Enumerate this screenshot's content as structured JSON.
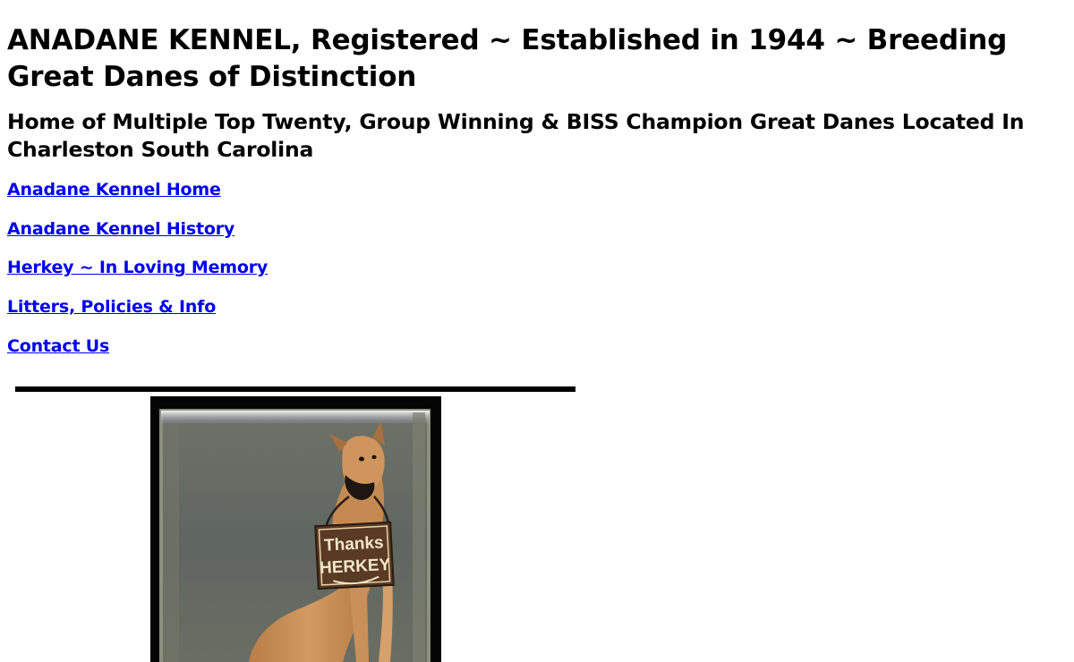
{
  "header": {
    "title": "ANADANE KENNEL, Registered ~ Established in 1944 ~ Breeding Great Danes of Distinction",
    "subtitle": "Home of Multiple Top Twenty, Group Winning & BISS Champion Great Danes Located In Charleston South Carolina"
  },
  "nav": {
    "links": [
      {
        "label": "Anadane Kennel Home"
      },
      {
        "label": "Anadane Kennel History"
      },
      {
        "label": "Herkey ~ In Loving Memory"
      },
      {
        "label": "Litters, Policies & Info"
      },
      {
        "label": "Contact Us"
      }
    ]
  },
  "photo": {
    "sign_line1": "Thanks",
    "sign_line2": "HERKEY"
  },
  "colors": {
    "link": "#0000ee",
    "divider": "#000000",
    "dog": "#c98f55",
    "sign": "#5a3a24"
  }
}
